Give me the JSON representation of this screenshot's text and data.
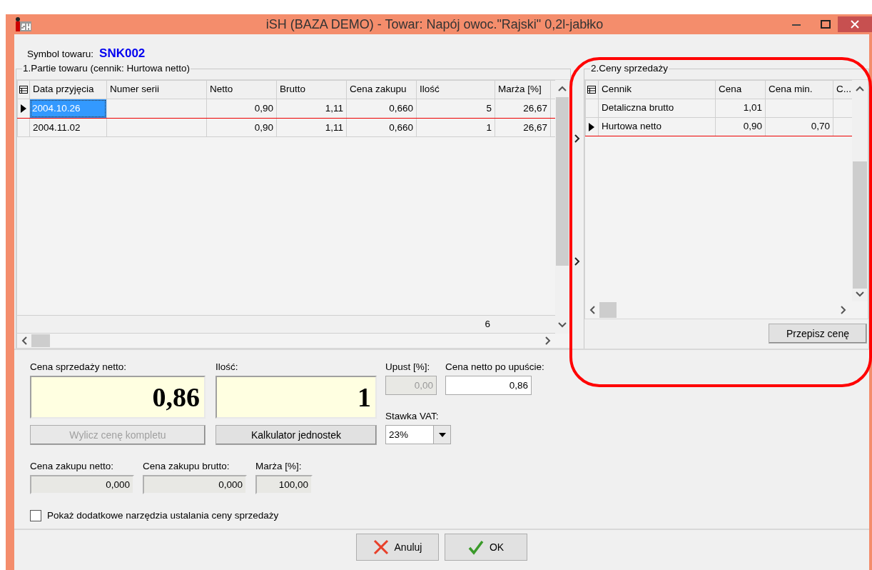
{
  "window": {
    "title": "iSH (BAZA DEMO) - Towar: Napój owoc.\"Rajski\" 0,2l-jabłko"
  },
  "symbol": {
    "label": "Symbol towaru:",
    "value": "SNK002"
  },
  "batches": {
    "title": "1.Partie towaru (cennik: Hurtowa netto)",
    "columns": [
      "Data przyjęcia",
      "Numer serii",
      "Netto",
      "Brutto",
      "Cena zakupu",
      "Ilość",
      "Marża [%]"
    ],
    "rows": [
      {
        "cells": [
          "2004.10.26",
          "",
          "0,90",
          "1,11",
          "0,660",
          "5",
          "26,67"
        ],
        "selected": true
      },
      {
        "cells": [
          "2004.11.02",
          "",
          "0,90",
          "1,11",
          "0,660",
          "1",
          "26,67"
        ],
        "selected": false
      }
    ],
    "footer": "6"
  },
  "prices": {
    "title": "2.Ceny sprzedaży",
    "columns": [
      "Cennik",
      "Cena",
      "Cena min.",
      "C..."
    ],
    "rows": [
      {
        "cells": [
          "Detaliczna brutto",
          "1,01",
          "",
          ""
        ],
        "selected": false
      },
      {
        "cells": [
          "Hurtowa netto",
          "0,90",
          "0,70",
          ""
        ],
        "selected": true
      }
    ],
    "button": "Przepisz cenę"
  },
  "sale_price": {
    "label": "Cena sprzedaży netto:",
    "value": "0,86"
  },
  "quantity": {
    "label": "Ilość:",
    "value": "1"
  },
  "discount": {
    "label": "Upust [%]:",
    "value": "0,00",
    "disabled": true
  },
  "net_after_discount": {
    "label": "Cena netto po upuście:",
    "value": "0,86"
  },
  "vat": {
    "label": "Stawka VAT:",
    "value": "23%"
  },
  "tools": [
    {
      "label": "Wylicz cenę kompletu",
      "disabled": true
    },
    {
      "label": "Kalkulator jednostek",
      "disabled": false
    }
  ],
  "purchase": [
    {
      "label": "Cena zakupu netto:",
      "value": "0,000"
    },
    {
      "label": "Cena zakupu brutto:",
      "value": "0,000"
    },
    {
      "label": "Marża [%]:",
      "value": "100,00"
    }
  ],
  "extra_tools": {
    "label": "Pokaż dodatkowe narzędzia ustalania ceny sprzedaży",
    "checked": false
  },
  "actions": [
    {
      "label": "Anuluj",
      "kind": "cancel"
    },
    {
      "label": "OK",
      "kind": "ok"
    }
  ]
}
